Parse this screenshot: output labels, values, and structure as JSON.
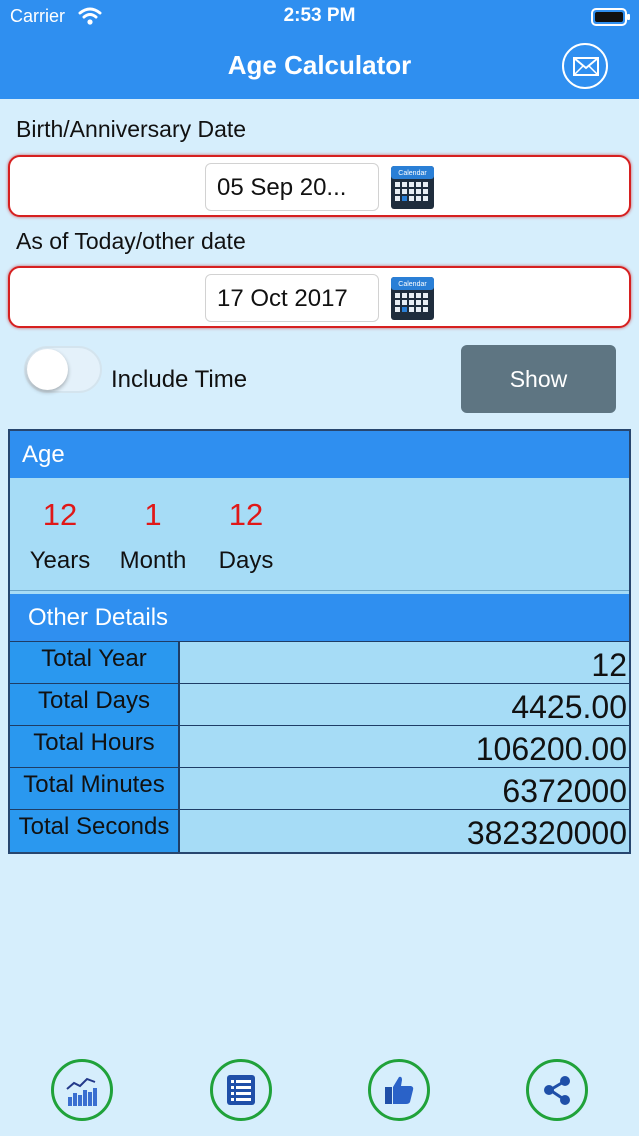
{
  "status_bar": {
    "carrier": "Carrier",
    "time": "2:53 PM"
  },
  "header": {
    "title": "Age Calculator",
    "mail_icon": "mail-icon"
  },
  "birth": {
    "label": "Birth/Anniversary Date",
    "value": "05 Sep 20...",
    "calendar_icon_text": "Calendar"
  },
  "asof": {
    "label": "As of Today/other date",
    "value": "17 Oct 2017",
    "calendar_icon_text": "Calendar"
  },
  "include_time": {
    "label": "Include Time",
    "on": false
  },
  "show_button": "Show",
  "age": {
    "heading": "Age",
    "years": {
      "value": "12",
      "unit": "Years"
    },
    "months": {
      "value": "1",
      "unit": "Month"
    },
    "days": {
      "value": "12",
      "unit": "Days"
    }
  },
  "details": {
    "heading": "Other Details",
    "rows": [
      {
        "label": "Total Year",
        "value": "12"
      },
      {
        "label": "Total Days",
        "value": "4425.00"
      },
      {
        "label": "Total Hours",
        "value": "106200.00"
      },
      {
        "label": "Total Minutes",
        "value": "6372000"
      },
      {
        "label": "Total Seconds",
        "value": "382320000"
      }
    ]
  },
  "bottom_bar": [
    "chart-icon",
    "list-icon",
    "thumbs-up-icon",
    "share-icon"
  ],
  "colors": {
    "header": "#2f8ff0",
    "accent_red": "#e01818",
    "show_button": "#5e7582",
    "bottom_ring": "#20a23a"
  }
}
